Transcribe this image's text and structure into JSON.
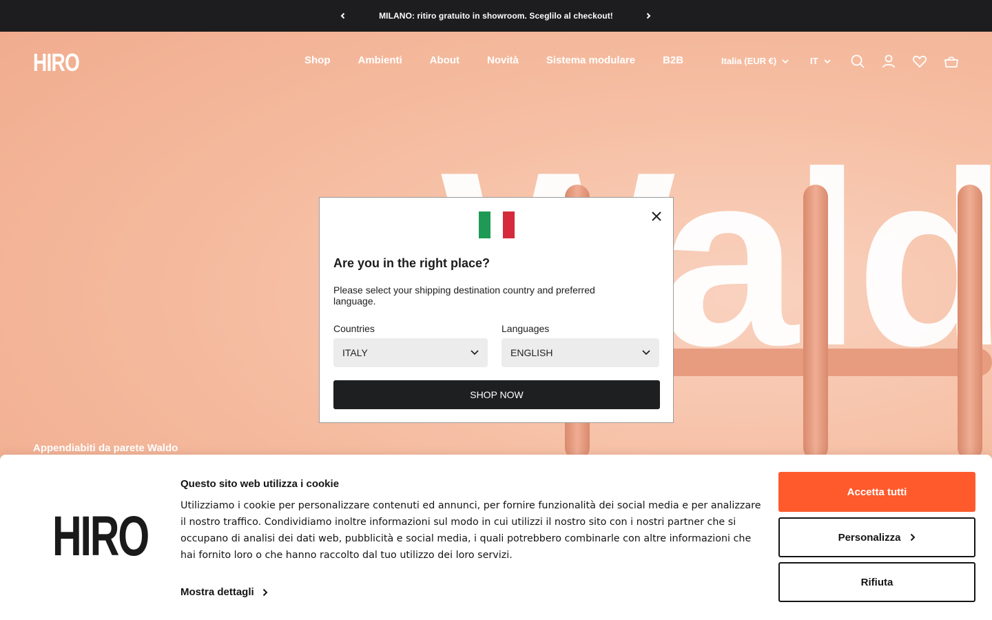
{
  "announcement": {
    "message": "MILANO: ritiro gratuito in showroom. Sceglilo al checkout!"
  },
  "header": {
    "logo": "HIRO",
    "nav": [
      "Shop",
      "Ambienti",
      "About",
      "Novità",
      "Sistema modulare",
      "B2B"
    ],
    "country_selector": "Italia (EUR €)",
    "language_selector": "IT"
  },
  "hero": {
    "background_word": "Waldo",
    "caption": "Appendiabiti da parete Waldo"
  },
  "modal": {
    "title": "Are you in the right place?",
    "description": "Please select your shipping destination country and preferred language.",
    "countries_label": "Countries",
    "countries_value": "ITALY",
    "languages_label": "Languages",
    "languages_value": "ENGLISH",
    "button": "SHOP NOW",
    "flag_colors": [
      "#1e9a55",
      "#ffffff",
      "#d42a3b"
    ]
  },
  "cookie": {
    "logo": "HIRO",
    "title": "Questo sito web utilizza i cookie",
    "text": "Utilizziamo i cookie per personalizzare contenuti ed annunci, per fornire funzionalità dei social media e per analizzare il nostro traffico. Condividiamo inoltre informazioni sul modo in cui utilizzi il nostro sito con i nostri partner che si occupano di analisi dei dati web, pubblicità e social media, i quali potrebbero combinarle con altre informazioni che hai fornito loro o che hanno raccolto dal tuo utilizzo dei loro servizi.",
    "details_link": "Mostra dettagli",
    "accept_button": "Accetta tutti",
    "customize_button": "Personalizza",
    "reject_button": "Rifiuta"
  },
  "colors": {
    "accent": "#ff5a2c",
    "dark": "#1d1d1f",
    "hero_bg": "#f4b89c"
  }
}
